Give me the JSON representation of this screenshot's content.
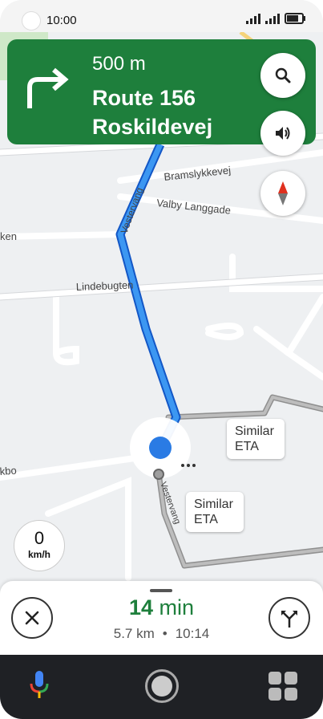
{
  "status_bar": {
    "time": "10:00"
  },
  "navigation": {
    "distance": "500 m",
    "street_line1": "Route 156",
    "street_line2": "Roskildevej",
    "maneuver_icon": "turn-right-arrow-icon"
  },
  "map": {
    "streets": [
      "Vestervang",
      "Bramslykkevej",
      "Valby Langgade",
      "Lindebugten",
      "Vestervang"
    ],
    "partial_labels": [
      "ken",
      "kbo"
    ],
    "alt_route_labels": [
      "Similar\nETA",
      "Similar\nETA"
    ],
    "route_color": "#1a73e8",
    "alt_route_color": "#9e9e9e"
  },
  "speedometer": {
    "value": "0",
    "unit": "km/h"
  },
  "trip": {
    "eta_number": "14",
    "eta_unit": "min",
    "distance": "5.7 km",
    "separator": "•",
    "arrival": "10:14"
  },
  "icons": {
    "search": "search-icon",
    "sound": "volume-icon",
    "compass": "compass-icon",
    "close": "close-icon",
    "alt_routes": "alternate-routes-icon",
    "mic": "mic-icon",
    "home": "home-icon",
    "apps": "app-grid-icon"
  },
  "colors": {
    "nav_green": "#1e7f3c",
    "eta_green": "#1e7f3c"
  }
}
